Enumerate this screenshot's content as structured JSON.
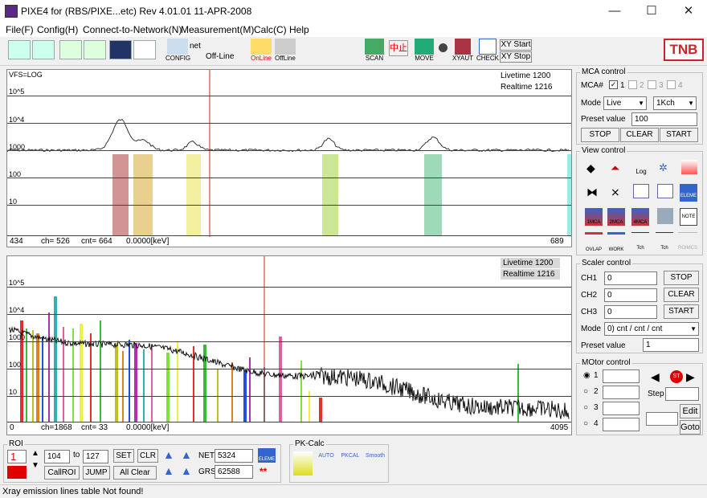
{
  "window": {
    "title": "PIXE4 for (RBS/PIXE...etc)  Rev 4.01.01  11-APR-2008",
    "minimize": "—",
    "maximize": "☐",
    "close": "✕"
  },
  "menu": [
    "File(F)",
    "Config(H)",
    "Connect-to-Network(N)",
    "Measurement(M)",
    "Calc(C)",
    "Help"
  ],
  "toolbar": {
    "net": "net",
    "offline_status": "Off-Line",
    "config": "CONFIG",
    "online": "OnLine",
    "offline": "OffLine",
    "scan": "SCAN",
    "stop_kanji": "中止",
    "move": "MOVE",
    "xyaut": "XYAUT",
    "check": "CHECK",
    "xy_start": "XY Start",
    "xy_stop": "XY Stop",
    "logo": "TNB"
  },
  "top_plot": {
    "vfs": "VFS=LOG",
    "livetime": "Livetime  1200",
    "realtime": "Realtime  1216",
    "yticks": [
      "10^5",
      "10^4",
      "1000",
      "100",
      "10"
    ],
    "footer_left": "434",
    "footer_ch": "ch= 526",
    "footer_cnt": "cnt=    664",
    "footer_kev": "0.0000[keV]",
    "footer_right": "689"
  },
  "bottom_plot": {
    "livetime": "Livetime  1200",
    "realtime": "Realtime  1216",
    "yticks": [
      "10^5",
      "10^4",
      "1000",
      "100",
      "10"
    ],
    "footer_left": "0",
    "footer_ch": "ch=1868",
    "footer_cnt": "cnt=      33",
    "footer_kev": "0.0000[keV]",
    "footer_right": "4095"
  },
  "mca": {
    "title": "MCA control",
    "mca_label": "MCA#",
    "chk1": "1",
    "chk2": "2",
    "chk3": "3",
    "chk4": "4",
    "mode_label": "Mode",
    "mode_value": "Live",
    "kch_value": "1Kch",
    "preset_label": "Preset value",
    "preset_value": "100",
    "stop": "STOP",
    "clear": "CLEAR",
    "start": "START"
  },
  "view": {
    "title": "View control",
    "log": "Log",
    "eleme": "ELEME",
    "mca1": "1MCA",
    "mca2": "2MCA",
    "mca4": "4MCA",
    "note": "NOTE",
    "ovlap": "OVLAP",
    "work": "WORK",
    "tch1": "Tch",
    "tch2": "Tch",
    "roimcs": "ROIMCS"
  },
  "scaler": {
    "title": "Scaler control",
    "ch1": "CH1",
    "ch1v": "0",
    "ch2": "CH2",
    "ch2v": "0",
    "ch3": "CH3",
    "ch3v": "0",
    "stop": "STOP",
    "clear": "CLEAR",
    "start": "START",
    "mode_label": "Mode",
    "mode_value": "0) cnt / cnt / cnt",
    "preset_label": "Preset value",
    "preset_value": "1"
  },
  "motor": {
    "title": "MOtor control",
    "r1": "1",
    "r2": "2",
    "r3": "3",
    "r4": "4",
    "step": "Step",
    "edit": "Edit",
    "goto": "Goto",
    "st": "ST"
  },
  "roi": {
    "title": "ROI",
    "index": "1",
    "from": "104",
    "to_label": "to",
    "to": "127",
    "set": "SET",
    "clr": "CLR",
    "callroi": "CallROI",
    "jump": "JUMP",
    "allclear": "All Clear",
    "net_label": "NET",
    "net": "5324",
    "grs_label": "GRS",
    "grs": "62588",
    "eleme": "ELEME",
    "stars": "**"
  },
  "pkcalc": {
    "title": "PK-Calc",
    "auto": "AUTO",
    "pkcal": "PKCAL",
    "smooth": "Smooth"
  },
  "status": "Xray emission lines table Not found!",
  "colors": {
    "accent_red": "#e00000",
    "logo_border": "#d0202a"
  }
}
